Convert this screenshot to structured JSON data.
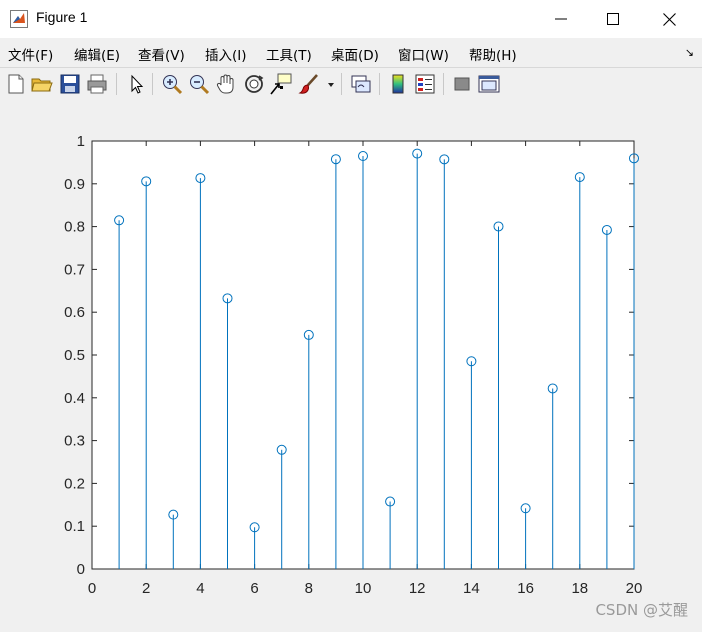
{
  "window": {
    "title": "Figure 1",
    "controls": {
      "minimize": "minimize",
      "maximize": "maximize",
      "close": "close"
    }
  },
  "menubar": {
    "items": [
      {
        "label": "文件(F)"
      },
      {
        "label": "编辑(E)"
      },
      {
        "label": "查看(V)"
      },
      {
        "label": "插入(I)"
      },
      {
        "label": "工具(T)"
      },
      {
        "label": "桌面(D)"
      },
      {
        "label": "窗口(W)"
      },
      {
        "label": "帮助(H)"
      }
    ],
    "dock_arrow": "↘"
  },
  "toolbar": {
    "buttons": [
      "new-figure-icon",
      "open-file-icon",
      "save-icon",
      "print-icon",
      "pointer-icon",
      "zoom-in-icon",
      "zoom-out-icon",
      "pan-icon",
      "rotate-3d-icon",
      "data-cursor-icon",
      "brush-icon",
      "link-plot-icon",
      "colorbar-icon",
      "legend-icon",
      "hide-plot-tools-icon",
      "show-plot-tools-icon"
    ]
  },
  "chart_data": {
    "type": "stem",
    "x": [
      1,
      2,
      3,
      4,
      5,
      6,
      7,
      8,
      9,
      10,
      11,
      12,
      13,
      14,
      15,
      16,
      17,
      18,
      19,
      20
    ],
    "values": [
      0.8147,
      0.9058,
      0.127,
      0.9134,
      0.6324,
      0.0975,
      0.2785,
      0.5469,
      0.9575,
      0.9649,
      0.1576,
      0.9706,
      0.9572,
      0.4854,
      0.8003,
      0.1419,
      0.4218,
      0.9157,
      0.7922,
      0.9595
    ],
    "xlim": [
      0,
      20
    ],
    "ylim": [
      0,
      1
    ],
    "xticks": [
      "0",
      "2",
      "4",
      "6",
      "8",
      "10",
      "12",
      "14",
      "16",
      "18",
      "20"
    ],
    "yticks": [
      "0",
      "0.1",
      "0.2",
      "0.3",
      "0.4",
      "0.5",
      "0.6",
      "0.7",
      "0.8",
      "0.9",
      "1"
    ],
    "marker": "circle",
    "color": "#0072bd",
    "grid": false,
    "title": "",
    "xlabel": "",
    "ylabel": ""
  },
  "watermark": "CSDN @艾醒"
}
